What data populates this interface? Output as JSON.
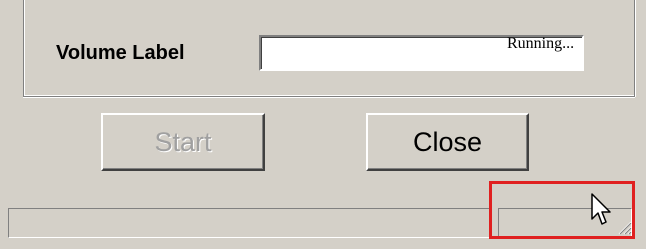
{
  "form": {
    "volume_label": "Volume Label",
    "volume_value": ""
  },
  "buttons": {
    "start_label": "Start",
    "close_label": "Close"
  },
  "statusbar": {
    "main_text": "",
    "running_text": "Running..."
  },
  "colors": {
    "window_bg": "#d4d0c8",
    "highlight": "#e02020",
    "disabled_text": "#a0a0a0"
  },
  "icons": {
    "cursor": "mouse-pointer-icon",
    "grip": "resize-grip-icon"
  }
}
